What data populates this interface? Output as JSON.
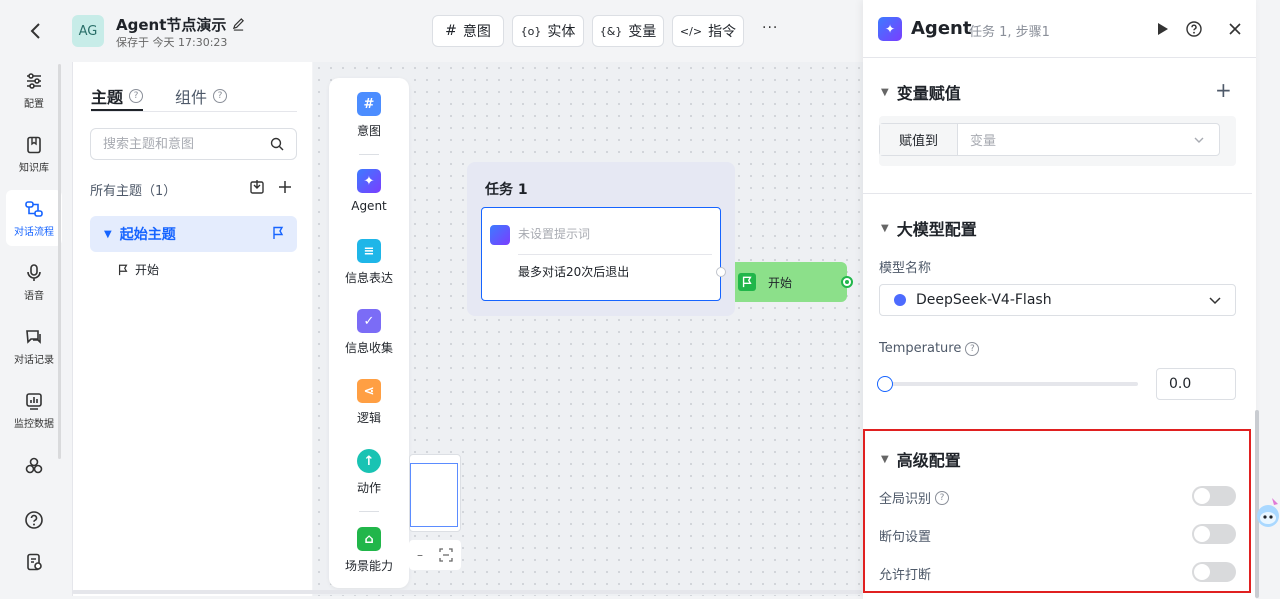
{
  "header": {
    "avatar": "AG",
    "title": "Agent节点演示",
    "saved": "保存于 今天 17:30:23",
    "buttons": [
      {
        "icon": "#",
        "label": "意图"
      },
      {
        "icon": "{o}",
        "label": "实体"
      },
      {
        "icon": "{&}",
        "label": "变量"
      },
      {
        "icon": "</>",
        "label": "指令"
      }
    ],
    "more": "···"
  },
  "rail": {
    "items": [
      {
        "label": "配置"
      },
      {
        "label": "知识库"
      },
      {
        "label": "对话流程"
      },
      {
        "label": "语音"
      },
      {
        "label": "对话记录"
      },
      {
        "label": "监控数据"
      }
    ]
  },
  "topics": {
    "tab_topic": "主题",
    "tab_component": "组件",
    "search_placeholder": "搜索主题和意图",
    "all_label": "所有主题（1）",
    "item_label": "起始主题",
    "sub_item": "开始"
  },
  "palette": {
    "items": [
      {
        "label": "意图",
        "color": "#4c8dff"
      },
      {
        "label": "Agent",
        "color": "#5b5bff"
      },
      {
        "label": "信息表达",
        "color": "#1fb6e8"
      },
      {
        "label": "信息收集",
        "color": "#7b6cf6"
      },
      {
        "label": "逻辑",
        "color": "#ff9f43"
      },
      {
        "label": "动作",
        "color": "#19c3b3"
      },
      {
        "label": "场景能力",
        "color": "#21b64a"
      }
    ]
  },
  "canvas": {
    "task_title": "任务 1",
    "prompt_placeholder": "未设置提示词",
    "exit_text": "最多对话20次后退出",
    "start_label": "开始"
  },
  "drawer": {
    "title": "Agent",
    "subtitle": "任务 1, 步骤1",
    "var_section": "变量赋值",
    "assign_label": "赋值到",
    "assign_placeholder": "变量",
    "model_section": "大模型配置",
    "model_name_label": "模型名称",
    "model_value": "DeepSeek-V4-Flash",
    "temperature_label": "Temperature",
    "temperature_value": "0.0",
    "temperature_level": 0.0,
    "adv_section": "高级配置",
    "global_recog": "全局识别",
    "sentence_setting": "断句设置",
    "allow_interrupt": "允许打断",
    "toggles": {
      "global_recog": false,
      "sentence_setting": false,
      "allow_interrupt": false
    }
  },
  "colors": {
    "accent": "#1664ff",
    "highlight": "#e02020",
    "start_green": "#8ce08a"
  }
}
